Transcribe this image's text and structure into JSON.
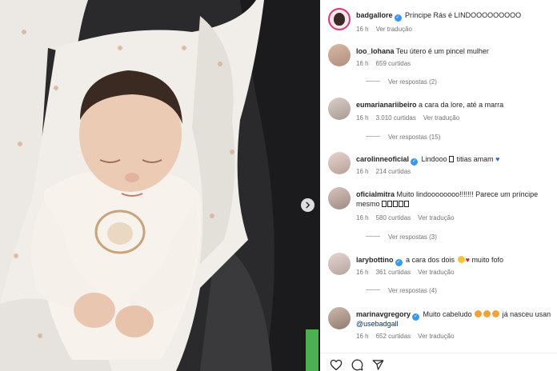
{
  "photo": {
    "next_icon": "chevron-right-icon"
  },
  "post": {
    "owner": "badgallore",
    "caption": "Príncipe Rás é LINDOOOOOOOOO",
    "time": "16 h",
    "translate": "Ver tradução"
  },
  "comments": [
    {
      "user": "loo_lohana",
      "verified": false,
      "text": "Teu útero é um pincel mulher",
      "time": "16 h",
      "likes": "659 curtidas",
      "translate": "",
      "replies": "Ver respostas (2)"
    },
    {
      "user": "eumarianariibeiro",
      "verified": false,
      "text": "a cara da lore, até a marra",
      "time": "16 h",
      "likes": "3.010 curtidas",
      "translate": "Ver tradução",
      "replies": "Ver respostas (15)"
    },
    {
      "user": "carolinneoficial",
      "verified": true,
      "text": "Lindooo",
      "text2": "titias amam",
      "time": "16 h",
      "likes": "214 curtidas",
      "translate": "",
      "replies": ""
    },
    {
      "user": "oficialmitra",
      "verified": false,
      "text": "Muito lindoooooooo!!!!!!! Parece um príncipe mesmo",
      "time": "16 h",
      "likes": "580 curtidas",
      "translate": "Ver tradução",
      "replies": "Ver respostas (3)"
    },
    {
      "user": "larybottino",
      "verified": true,
      "text": "a cara dos dois",
      "text2": "muito fofo",
      "time": "16 h",
      "likes": "361 curtidas",
      "translate": "Ver tradução",
      "replies": "Ver respostas (4)"
    },
    {
      "user": "marinavgregory",
      "verified": true,
      "text": "Muito cabeludo",
      "text2": "já nasceu usan",
      "mention": "@usebadgall",
      "time": "16 h",
      "likes": "652 curtidas",
      "translate": "Ver tradução",
      "replies": ""
    }
  ],
  "actions": [
    "heart-icon",
    "comment-icon",
    "share-icon"
  ],
  "colors": {
    "verified": "#3897f0",
    "muted": "#737373",
    "mention": "#00376b"
  }
}
